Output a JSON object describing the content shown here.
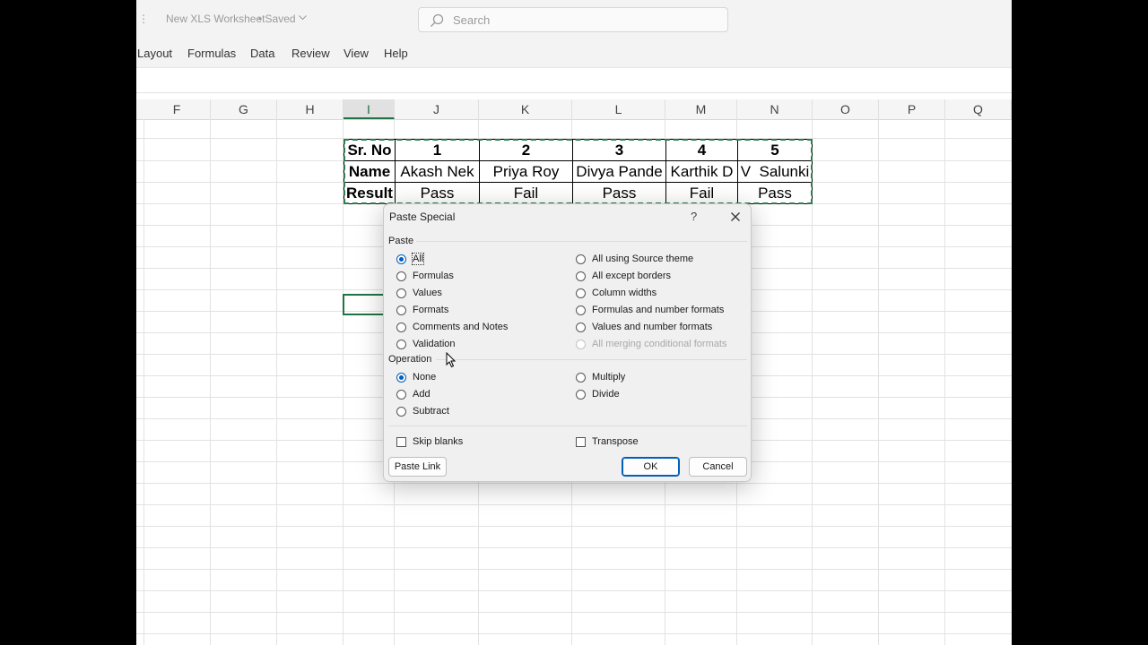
{
  "window": {
    "title": "New XLS Worksheet",
    "status": "Saved",
    "search_placeholder": "Search"
  },
  "ribbon": {
    "tabs": [
      "Layout",
      "Formulas",
      "Data",
      "Review",
      "View",
      "Help"
    ]
  },
  "sheet": {
    "columns": [
      "F",
      "G",
      "H",
      "I",
      "J",
      "K",
      "L",
      "M",
      "N",
      "O",
      "P",
      "Q"
    ],
    "selected_column": "I",
    "table": [
      [
        "Sr. No",
        "1",
        "2",
        "3",
        "4",
        "5"
      ],
      [
        "Name",
        "Akash Nek",
        "Priya Roy",
        "Divya Pande",
        "Karthik D",
        "V  Salunki"
      ],
      [
        "Result",
        "Pass",
        "Fail",
        "Pass",
        "Fail",
        "Pass"
      ]
    ]
  },
  "dialog": {
    "title": "Paste Special",
    "help": "?",
    "paste_group": "Paste",
    "paste_options_left": [
      "All",
      "Formulas",
      "Values",
      "Formats",
      "Comments and Notes",
      "Validation"
    ],
    "paste_options_right": [
      "All using Source theme",
      "All except borders",
      "Column widths",
      "Formulas and number formats",
      "Values and number formats",
      "All merging conditional formats"
    ],
    "paste_selected": "All",
    "paste_disabled": "All merging conditional formats",
    "operation_group": "Operation",
    "operation_options_left": [
      "None",
      "Add",
      "Subtract"
    ],
    "operation_options_right": [
      "Multiply",
      "Divide"
    ],
    "operation_selected": "None",
    "skip_blanks": "Skip blanks",
    "transpose": "Transpose",
    "paste_link": "Paste Link",
    "ok": "OK",
    "cancel": "Cancel"
  },
  "colors": {
    "accent": "#005fb8",
    "excel_green": "#217346"
  }
}
